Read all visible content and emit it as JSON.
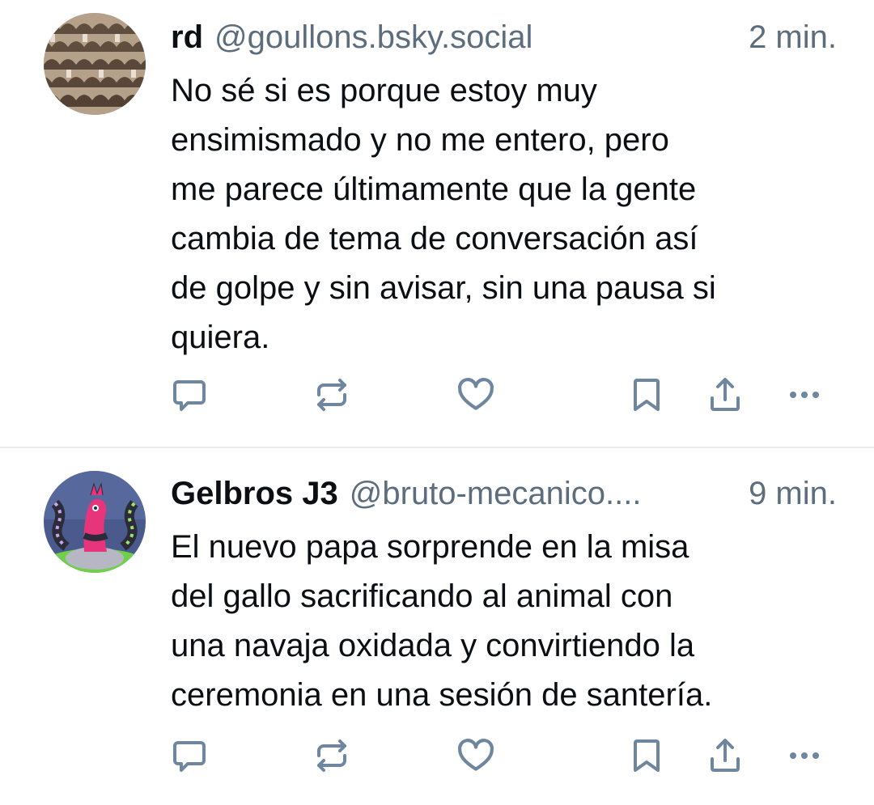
{
  "posts": [
    {
      "display_name": "rd",
      "handle": "@goullons.bsky.social",
      "time": "2 min.",
      "text_lines": [
        "No sé si es porque estoy muy",
        "ensimismado y no me entero, pero",
        "me parece últimamente que la gente",
        "cambia de tema de conversación así",
        "de golpe y sin avisar, sin una pausa si",
        "quiera."
      ],
      "avatar_icon": "archway-photo",
      "actions": [
        "reply-icon",
        "repost-icon",
        "like-icon",
        "bookmark-icon",
        "share-icon",
        "more-icon"
      ]
    },
    {
      "display_name": "Gelbros J3",
      "handle": "@bruto-mecanico....",
      "time": "9 min.",
      "text_lines": [
        "El nuevo papa sorprende en la misa",
        "del gallo sacrificando al animal con",
        "una navaja oxidada y convirtiendo la",
        "ceremonia en una sesión de santería."
      ],
      "avatar_icon": "cartoon-creature",
      "actions": [
        "reply-icon",
        "repost-icon",
        "like-icon",
        "bookmark-icon",
        "share-icon",
        "more-icon"
      ]
    }
  ],
  "colors": {
    "text": "#0b0f14",
    "muted": "#5c6d7e",
    "icon": "#6f869f",
    "divider": "#e9ecef"
  }
}
